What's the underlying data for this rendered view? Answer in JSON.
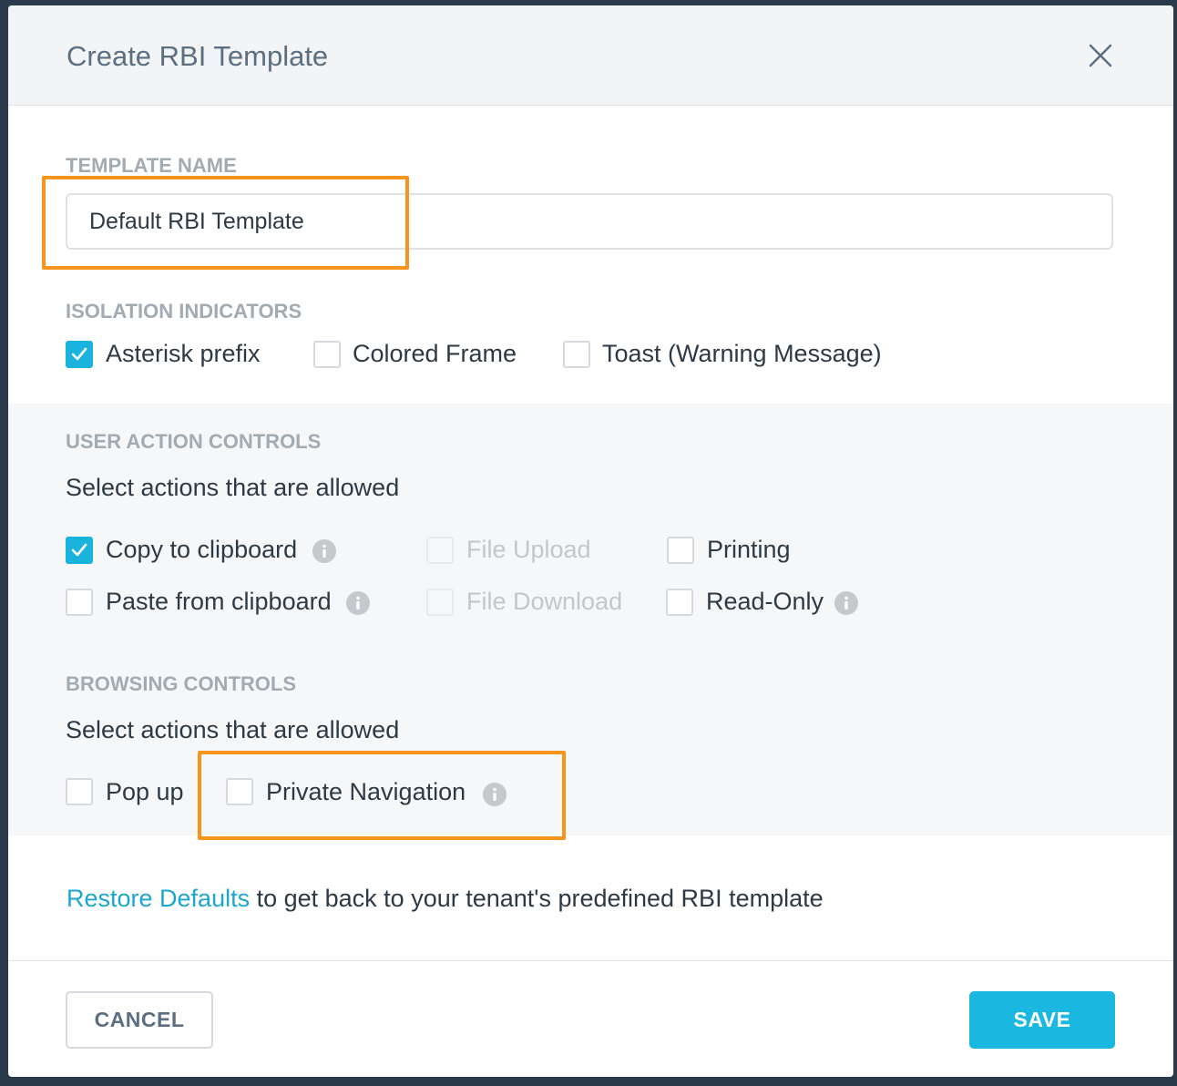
{
  "dialog": {
    "title": "Create RBI Template",
    "close_icon": "close-icon"
  },
  "template_name": {
    "label": "TEMPLATE NAME",
    "value": "Default RBI Template"
  },
  "isolation_indicators": {
    "label": "ISOLATION INDICATORS",
    "options": [
      {
        "label": "Asterisk prefix",
        "checked": true
      },
      {
        "label": "Colored Frame",
        "checked": false
      },
      {
        "label": "Toast (Warning Message)",
        "checked": false
      }
    ]
  },
  "user_action_controls": {
    "label": "USER ACTION CONTROLS",
    "subtitle": "Select actions that are allowed",
    "options": [
      {
        "label": "Copy to clipboard",
        "checked": true,
        "disabled": false,
        "info_icon": "info-icon"
      },
      {
        "label": "Paste from clipboard",
        "checked": false,
        "disabled": false,
        "info_icon": "info-icon"
      },
      {
        "label": "File Upload",
        "checked": false,
        "disabled": true
      },
      {
        "label": "File Download",
        "checked": false,
        "disabled": true
      },
      {
        "label": "Printing",
        "checked": false,
        "disabled": false
      },
      {
        "label": "Read-Only",
        "checked": false,
        "disabled": false,
        "info_icon": "info-icon"
      }
    ]
  },
  "browsing_controls": {
    "label": "BROWSING CONTROLS",
    "subtitle": "Select actions that are allowed",
    "options": [
      {
        "label": "Pop up",
        "checked": false
      },
      {
        "label": "Private Navigation",
        "checked": false,
        "info_icon": "info-icon"
      }
    ]
  },
  "restore": {
    "link_text": "Restore Defaults",
    "rest_text": " to get back to your tenant's predefined RBI template"
  },
  "footer": {
    "cancel_label": "CANCEL",
    "save_label": "SAVE"
  },
  "colors": {
    "accent": "#1ab8e0",
    "highlight": "#f7941d",
    "link": "#1ba6d4"
  }
}
